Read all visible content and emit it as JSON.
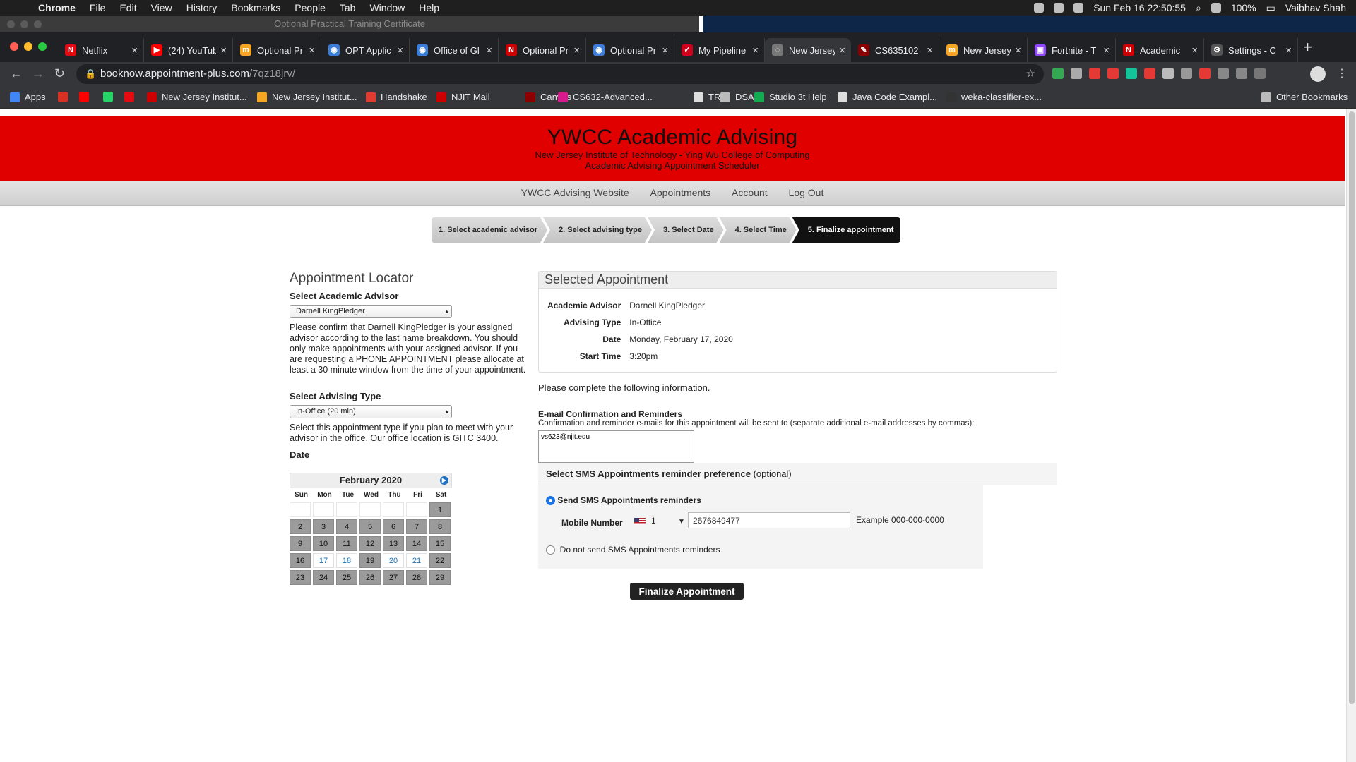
{
  "menubar": {
    "app": "Chrome",
    "items": [
      "File",
      "Edit",
      "View",
      "History",
      "Bookmarks",
      "People",
      "Tab",
      "Window",
      "Help"
    ],
    "datetime": "Sun Feb 16  22:50:55",
    "battery": "100%",
    "user": "Vaibhav Shah"
  },
  "background_window": {
    "title": "Optional Practical Training Certificate"
  },
  "tabs": [
    {
      "label": "Netflix",
      "color": "#e50914",
      "glyph": "N"
    },
    {
      "label": "(24) YouTub",
      "color": "#ff0000",
      "glyph": "▶"
    },
    {
      "label": "Optional Pr",
      "color": "#f5a623",
      "glyph": "m"
    },
    {
      "label": "OPT Applic",
      "color": "#3b7dd8",
      "glyph": "◉"
    },
    {
      "label": "Office of Gl",
      "color": "#3b7dd8",
      "glyph": "◉"
    },
    {
      "label": "Optional Pr",
      "color": "#cc0000",
      "glyph": "N"
    },
    {
      "label": "Optional Pr",
      "color": "#3b7dd8",
      "glyph": "◉"
    },
    {
      "label": "My Pipeline",
      "color": "#d0021b",
      "glyph": "✓"
    },
    {
      "label": "New Jersey",
      "color": "#777777",
      "glyph": "◌"
    },
    {
      "label": "CS635102",
      "color": "#8b0000",
      "glyph": "✎"
    },
    {
      "label": "New Jersey",
      "color": "#f5a623",
      "glyph": "m"
    },
    {
      "label": "Fortnite - T",
      "color": "#9146ff",
      "glyph": "▣"
    },
    {
      "label": "Academic",
      "color": "#cc0000",
      "glyph": "N"
    },
    {
      "label": "Settings - C",
      "color": "#555555",
      "glyph": "⚙"
    }
  ],
  "address": {
    "host": "booknow.appointment-plus.com",
    "path": "/7qz18jrv/"
  },
  "bookmarks": [
    {
      "label": "Apps",
      "color": "#4285f4"
    },
    {
      "label": "",
      "color": "#d93025"
    },
    {
      "label": "",
      "color": "#ff0000"
    },
    {
      "label": "",
      "color": "#25d366"
    },
    {
      "label": "",
      "color": "#e50914"
    },
    {
      "label": "New Jersey Institut...",
      "color": "#cc0000"
    },
    {
      "label": "New Jersey Institut...",
      "color": "#f5a623"
    },
    {
      "label": "Handshake",
      "color": "#e03c31"
    },
    {
      "label": "NJIT Mail",
      "color": "#cc0000"
    },
    {
      "label": "Canvas",
      "color": "#8b0000"
    },
    {
      "label": "CS632-Advanced...",
      "color": "#d81b8c"
    },
    {
      "label": "TR3",
      "color": "#dddddd"
    },
    {
      "label": "DSA",
      "color": "#bbbbbb"
    },
    {
      "label": "Studio 3t Help",
      "color": "#13aa52"
    },
    {
      "label": "Java Code Exampl...",
      "color": "#dddddd"
    },
    {
      "label": "weka-classifier-ex...",
      "color": "#333333"
    },
    {
      "label": "Other Bookmarks",
      "color": "#bbbbbb"
    }
  ],
  "site": {
    "title": "YWCC Academic Advising",
    "subtitle1": "New Jersey Institute of Technology - Ying Wu College of Computing",
    "subtitle2": "Academic Advising Appointment Scheduler",
    "nav": [
      "YWCC Advising Website",
      "Appointments",
      "Account",
      "Log Out"
    ],
    "steps": [
      "1. Select academic advisor",
      "2. Select advising type",
      "3. Select Date",
      "4. Select Time",
      "5. Finalize appointment"
    ],
    "active_step_index": 4
  },
  "locator": {
    "title": "Appointment Locator",
    "advisor_label": "Select Academic Advisor",
    "advisor_value": "Darnell KingPledger",
    "advisor_note": "Please confirm that Darnell KingPledger is your assigned advisor according to the last name breakdown. You should only make appointments with your assigned advisor. If you are requesting a PHONE APPOINTMENT please allocate at least a 30 minute window from the time of your appointment.",
    "type_label": "Select Advising Type",
    "type_value": "In-Office (20 min)",
    "type_note": "Select this appointment type if you plan to meet with your advisor in the office. Our office location is GITC 3400.",
    "date_label": "Date"
  },
  "calendar": {
    "month": "February 2020",
    "dow": [
      "Sun",
      "Mon",
      "Tue",
      "Wed",
      "Thu",
      "Fri",
      "Sat"
    ],
    "leading_blanks": 6,
    "days": 29,
    "available": [
      17,
      18,
      20,
      21
    ]
  },
  "selected": {
    "title": "Selected Appointment",
    "rows": [
      {
        "k": "Academic Advisor",
        "v": "Darnell KingPledger"
      },
      {
        "k": "Advising Type",
        "v": "In-Office"
      },
      {
        "k": "Date",
        "v": "Monday, February 17, 2020"
      },
      {
        "k": "Start Time",
        "v": "3:20pm"
      }
    ]
  },
  "form": {
    "intro": "Please complete the following information.",
    "email_title": "E-mail Confirmation and Reminders",
    "email_desc": "Confirmation and reminder e-mails for this appointment will be sent to (separate additional e-mail addresses by commas):",
    "email_value": "vs623@njit.edu",
    "sms_title": "Select SMS Appointments reminder preference",
    "sms_optional": "(optional)",
    "sms_on_label": "Send SMS Appointments reminders",
    "mobile_label": "Mobile Number",
    "country_code": "1",
    "mobile_value": "2676849477",
    "mobile_example": "Example 000-000-0000",
    "sms_off_label": "Do not send SMS Appointments reminders",
    "sms_selected": "on",
    "submit_label": "Finalize  Appointment"
  }
}
